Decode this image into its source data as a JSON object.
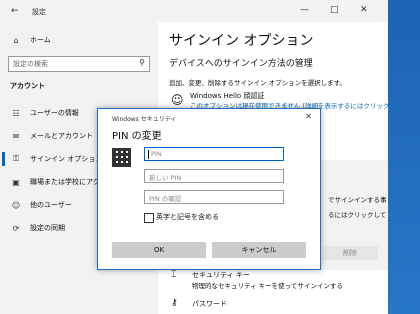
{
  "window": {
    "title": "設定",
    "back_icon": "back-arrow-icon",
    "controls": [
      "—",
      "□",
      "✕"
    ]
  },
  "sidebar": {
    "home": {
      "label": "ホーム",
      "icon": "home-icon"
    },
    "search_placeholder": "設定の検索",
    "section": "アカウント",
    "items": [
      {
        "label": "ユーザーの情報",
        "icon": "person-card-icon"
      },
      {
        "label": "メールとアカウント",
        "icon": "mail-icon"
      },
      {
        "label": "サインイン オプション",
        "icon": "key-icon",
        "active": true
      },
      {
        "label": "職場または学校にアクセスする",
        "icon": "briefcase-icon"
      },
      {
        "label": "他のユーザー",
        "icon": "people-icon"
      },
      {
        "label": "設定の同期",
        "icon": "sync-icon"
      }
    ]
  },
  "main": {
    "title": "サインイン オプション",
    "subtitle": "デバイスへのサインイン方法の管理",
    "description": "追加、変更、削除するサインイン オプションを選択します。",
    "hello": {
      "title": "Windows Hello 顔認証",
      "note": "このオプションは現在使用できません (詳細を表示するにはクリックして"
    },
    "right_text_1": "でサインインする事",
    "right_text_2": "るにはクリックして",
    "remove_button": "削除",
    "security_key": {
      "title": "セキュリティ キー",
      "desc": "物理的なセキュリティ キーを使ってサインインする"
    },
    "password": {
      "title": "パスワード"
    }
  },
  "dialog": {
    "caption": "Windows セキュリティ",
    "title": "PIN の変更",
    "fields": {
      "pin": "PIN",
      "new_pin": "新しい PIN",
      "confirm_pin": "PIN の確認"
    },
    "checkbox_label": "英字と記号を含める",
    "checkbox_checked": false,
    "ok": "OK",
    "cancel": "キャンセル"
  },
  "colors": {
    "accent": "#0067c0",
    "desktop": "#1f66b8"
  }
}
